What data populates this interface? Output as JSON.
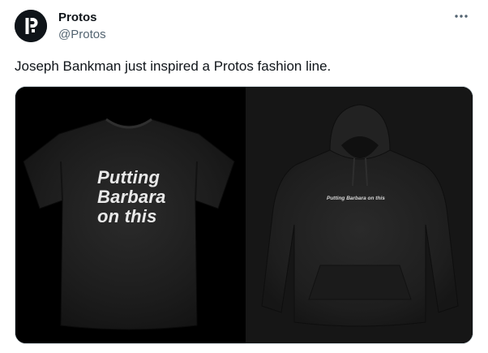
{
  "author": {
    "name": "Protos",
    "handle": "@Protos",
    "avatar_icon": "protos-logo-icon",
    "avatar_color": "#0f1419"
  },
  "more_icon": "more-horizontal-icon",
  "tweet_text": "Joseph Bankman just inspired a Protos fashion line.",
  "media": [
    {
      "kind": "t-shirt",
      "print_lines": [
        "Putting",
        "Barbara",
        "on this"
      ]
    },
    {
      "kind": "hoodie",
      "print_text": "Putting Barbara on this"
    }
  ],
  "colors": {
    "text_primary": "#0f1419",
    "text_secondary": "#536471",
    "border": "#cfd9de"
  }
}
